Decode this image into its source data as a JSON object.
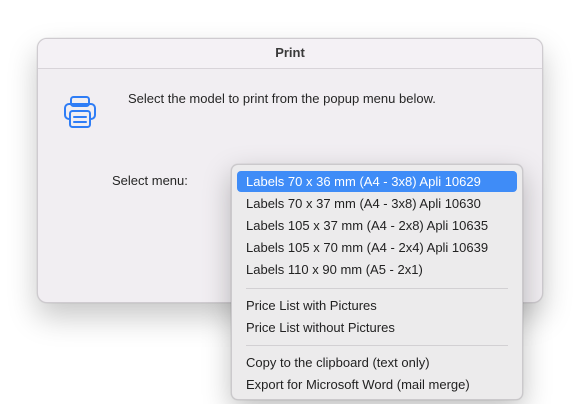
{
  "dialog": {
    "title": "Print",
    "message": "Select the model to print from the popup menu below.",
    "select_label": "Select menu:",
    "icon": "printer-icon"
  },
  "menu": {
    "selected_index": 0,
    "accent_color": "#3f8cf7",
    "items": [
      "Labels 70 x 36 mm (A4 - 3x8) Apli 10629",
      "Labels 70 x 37 mm (A4 - 3x8) Apli 10630",
      "Labels 105 x 37 mm (A4 - 2x8) Apli 10635",
      "Labels 105 x 70 mm (A4 - 2x4) Apli 10639",
      "Labels 110 x 90 mm (A5 - 2x1)",
      "Price List with Pictures",
      "Price List without Pictures",
      "Copy to the clipboard (text only)",
      "Export for Microsoft Word (mail merge)"
    ]
  }
}
